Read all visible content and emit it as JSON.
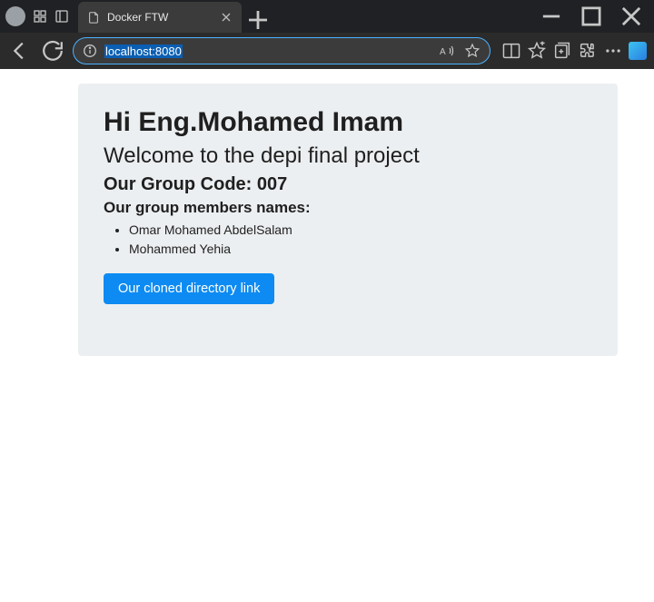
{
  "browser": {
    "tab_title": "Docker FTW",
    "url_selected": "localhost:8080"
  },
  "page": {
    "h1": "Hi Eng.Mohamed Imam",
    "h2": "Welcome to the depi final project",
    "h3": "Our Group Code: 007",
    "h4": "Our group members names:",
    "members": [
      "Omar Mohamed AbdelSalam",
      "Mohammed Yehia"
    ],
    "button_label": "Our cloned directory link"
  }
}
